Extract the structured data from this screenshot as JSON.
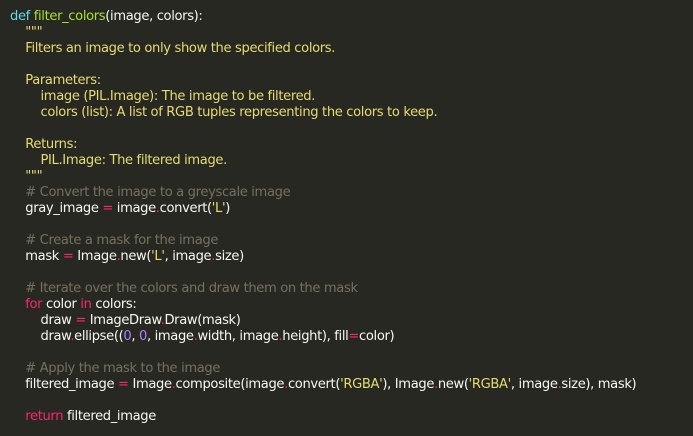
{
  "code": {
    "language": "python",
    "lines": [
      [
        {
          "t": "kw",
          "v": "def "
        },
        {
          "t": "fn",
          "v": "filter_colors"
        },
        {
          "t": "plain",
          "v": "(image, colors):"
        }
      ],
      [
        {
          "t": "doc",
          "v": "    \"\"\""
        }
      ],
      [
        {
          "t": "doc",
          "v": "    Filters an image to only show the specified colors."
        }
      ],
      [
        {
          "t": "plain",
          "v": ""
        }
      ],
      [
        {
          "t": "doc",
          "v": "    Parameters:"
        }
      ],
      [
        {
          "t": "doc",
          "v": "        image (PIL.Image): The image to be filtered."
        }
      ],
      [
        {
          "t": "doc",
          "v": "        colors (list): A list of RGB tuples representing the colors to keep."
        }
      ],
      [
        {
          "t": "plain",
          "v": ""
        }
      ],
      [
        {
          "t": "doc",
          "v": "    Returns:"
        }
      ],
      [
        {
          "t": "doc",
          "v": "        PIL.Image: The filtered image."
        }
      ],
      [
        {
          "t": "doc",
          "v": "    \"\"\""
        }
      ],
      [
        {
          "t": "com",
          "v": "    # Convert the image to a greyscale image"
        }
      ],
      [
        {
          "t": "plain",
          "v": "    gray_image "
        },
        {
          "t": "op",
          "v": "="
        },
        {
          "t": "plain",
          "v": " image"
        },
        {
          "t": "op",
          "v": "."
        },
        {
          "t": "plain",
          "v": "convert("
        },
        {
          "t": "str",
          "v": "'L'"
        },
        {
          "t": "plain",
          "v": ")"
        }
      ],
      [
        {
          "t": "plain",
          "v": ""
        }
      ],
      [
        {
          "t": "com",
          "v": "    # Create a mask for the image"
        }
      ],
      [
        {
          "t": "plain",
          "v": "    mask "
        },
        {
          "t": "op",
          "v": "="
        },
        {
          "t": "plain",
          "v": " Image"
        },
        {
          "t": "op",
          "v": "."
        },
        {
          "t": "plain",
          "v": "new("
        },
        {
          "t": "str",
          "v": "'L'"
        },
        {
          "t": "plain",
          "v": ", image"
        },
        {
          "t": "op",
          "v": "."
        },
        {
          "t": "plain",
          "v": "size)"
        }
      ],
      [
        {
          "t": "plain",
          "v": ""
        }
      ],
      [
        {
          "t": "com",
          "v": "    # Iterate over the colors and draw them on the mask"
        }
      ],
      [
        {
          "t": "kw-red",
          "v": "    for"
        },
        {
          "t": "plain",
          "v": " color "
        },
        {
          "t": "kw-red",
          "v": "in"
        },
        {
          "t": "plain",
          "v": " colors:"
        }
      ],
      [
        {
          "t": "plain",
          "v": "        draw "
        },
        {
          "t": "op",
          "v": "="
        },
        {
          "t": "plain",
          "v": " ImageDraw"
        },
        {
          "t": "op",
          "v": "."
        },
        {
          "t": "plain",
          "v": "Draw(mask)"
        }
      ],
      [
        {
          "t": "plain",
          "v": "        draw"
        },
        {
          "t": "op",
          "v": "."
        },
        {
          "t": "plain",
          "v": "ellipse(("
        },
        {
          "t": "num",
          "v": "0"
        },
        {
          "t": "plain",
          "v": ", "
        },
        {
          "t": "num",
          "v": "0"
        },
        {
          "t": "plain",
          "v": ", image"
        },
        {
          "t": "op",
          "v": "."
        },
        {
          "t": "plain",
          "v": "width, image"
        },
        {
          "t": "op",
          "v": "."
        },
        {
          "t": "plain",
          "v": "height), fill"
        },
        {
          "t": "op",
          "v": "="
        },
        {
          "t": "plain",
          "v": "color)"
        }
      ],
      [
        {
          "t": "plain",
          "v": ""
        }
      ],
      [
        {
          "t": "com",
          "v": "    # Apply the mask to the image"
        }
      ],
      [
        {
          "t": "plain",
          "v": "    filtered_image "
        },
        {
          "t": "op",
          "v": "="
        },
        {
          "t": "plain",
          "v": " Image"
        },
        {
          "t": "op",
          "v": "."
        },
        {
          "t": "plain",
          "v": "composite(image"
        },
        {
          "t": "op",
          "v": "."
        },
        {
          "t": "plain",
          "v": "convert("
        },
        {
          "t": "str",
          "v": "'RGBA'"
        },
        {
          "t": "plain",
          "v": "), Image"
        },
        {
          "t": "op",
          "v": "."
        },
        {
          "t": "plain",
          "v": "new("
        },
        {
          "t": "str",
          "v": "'RGBA'"
        },
        {
          "t": "plain",
          "v": ", image"
        },
        {
          "t": "op",
          "v": "."
        },
        {
          "t": "plain",
          "v": "size), mask)"
        }
      ],
      [
        {
          "t": "plain",
          "v": ""
        }
      ],
      [
        {
          "t": "kw-red",
          "v": "    return"
        },
        {
          "t": "plain",
          "v": " filtered_image"
        }
      ]
    ]
  },
  "colors": {
    "background": "#272822",
    "plain": "#f8f8f2",
    "keyword": "#66d9ef",
    "keyword_control": "#f92672",
    "function": "#a6e22e",
    "string": "#e6db74",
    "comment": "#75715e",
    "number": "#ae81ff"
  }
}
